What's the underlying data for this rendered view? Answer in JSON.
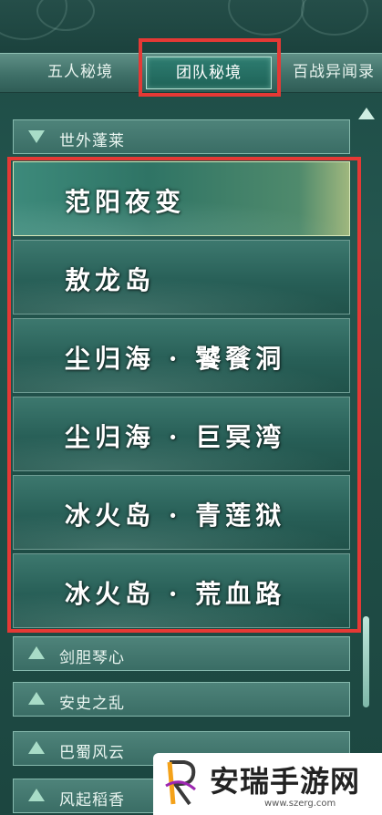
{
  "tabs": [
    {
      "label": "五人秘境",
      "active": false
    },
    {
      "label": "团队秘境",
      "active": true
    },
    {
      "label": "百战异闻录",
      "active": false
    }
  ],
  "sections": {
    "expanded": {
      "label": "世外蓬莱"
    },
    "collapsed": [
      {
        "label": "剑胆琴心"
      },
      {
        "label": "安史之乱"
      },
      {
        "label": "巴蜀风云"
      },
      {
        "label": "风起稻香"
      }
    ]
  },
  "dungeons": [
    {
      "name": "范阳夜变",
      "selected": true
    },
    {
      "name": "敖龙岛",
      "selected": false
    },
    {
      "name": "尘归海 · 饕餮洞",
      "selected": false
    },
    {
      "name": "尘归海 · 巨冥湾",
      "selected": false
    },
    {
      "name": "冰火岛 · 青莲狱",
      "selected": false
    },
    {
      "name": "冰火岛 · 荒血路",
      "selected": false
    }
  ],
  "watermark": {
    "title": "安瑞手游网",
    "url": "www.szerg.com"
  },
  "colors": {
    "highlight": "#e53935",
    "panel": "#24564f",
    "accent": "#a8dcc7"
  }
}
